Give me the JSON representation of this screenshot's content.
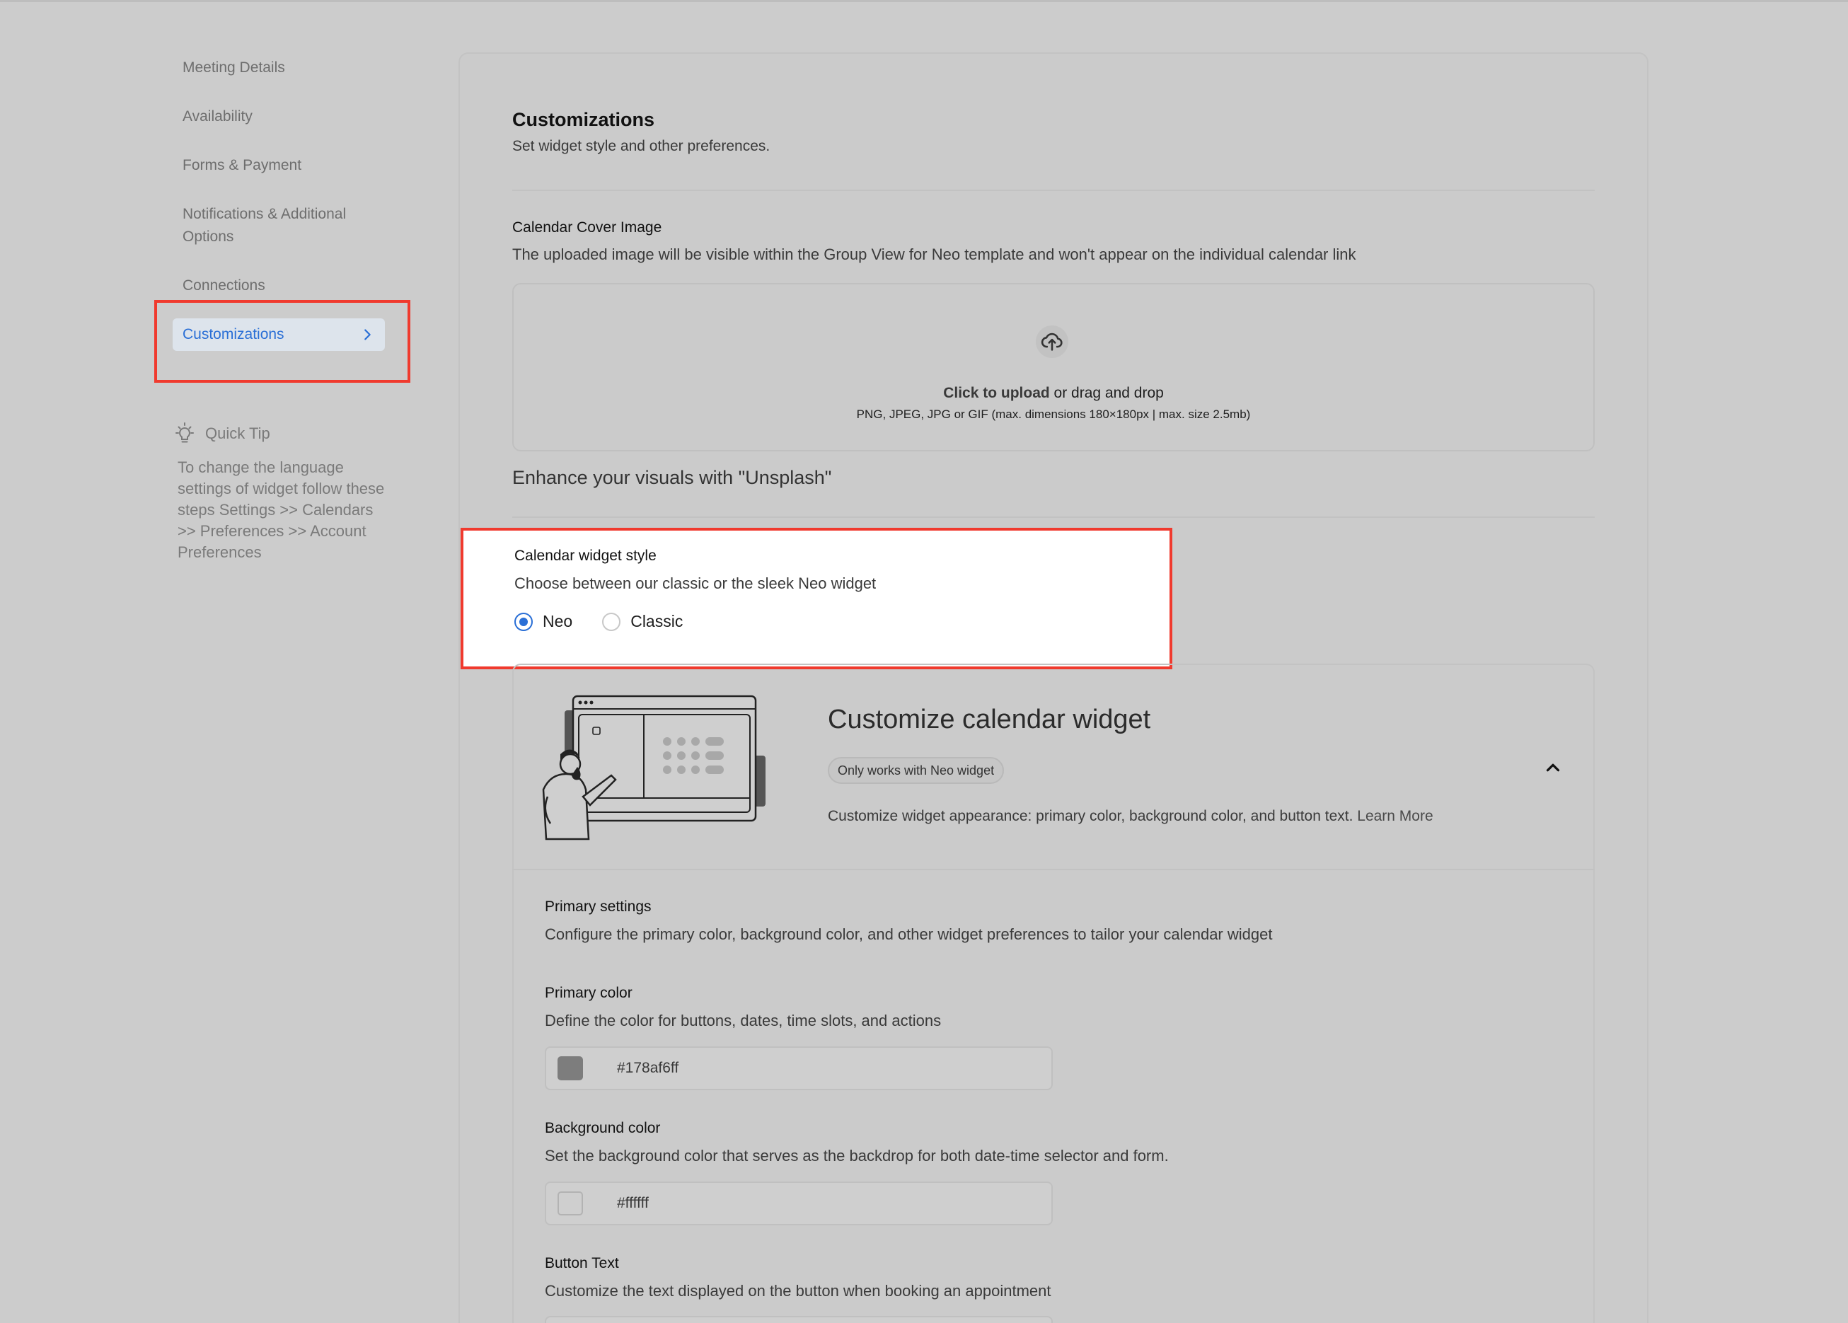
{
  "sidebar": {
    "items": [
      {
        "label": "Meeting Details"
      },
      {
        "label": "Availability"
      },
      {
        "label": "Forms & Payment"
      },
      {
        "label": "Notifications & Additional Options"
      },
      {
        "label": "Connections"
      },
      {
        "label": "Customizations",
        "active": true
      }
    ],
    "quick_tip": {
      "title": "Quick Tip",
      "text": "To change the language settings of widget follow these steps Settings >> Calendars >> Preferences >> Account Preferences"
    }
  },
  "main": {
    "title": "Customizations",
    "subtitle": "Set widget style and other preferences.",
    "cover_image": {
      "label": "Calendar Cover Image",
      "description": "The uploaded image will be visible within the Group View for Neo template and won't appear on the individual calendar link",
      "upload_link": "Click to upload",
      "upload_rest": " or drag and drop",
      "upload_hint": "PNG, JPEG, JPG or GIF (max. dimensions 180×180px | max. size 2.5mb)"
    },
    "unsplash": "Enhance your visuals with \"Unsplash\"",
    "widget_style": {
      "label": "Calendar widget style",
      "description": "Choose between our classic or the sleek Neo widget",
      "options": [
        {
          "label": "Neo",
          "selected": true
        },
        {
          "label": "Classic",
          "selected": false
        }
      ]
    },
    "customize_widget": {
      "title": "Customize calendar widget",
      "badge": "Only works with Neo widget",
      "description": "Customize widget appearance: primary color, background color, and button text.",
      "learn_more": "Learn More",
      "primary_settings": {
        "label": "Primary settings",
        "description": "Configure the primary color, background color, and other widget preferences to tailor your calendar widget"
      },
      "primary_color": {
        "label": "Primary color",
        "description": "Define the color for buttons, dates, time slots, and actions",
        "value": "#178af6ff",
        "swatch": "#7d7d7d"
      },
      "background_color": {
        "label": "Background color",
        "description": "Set the background color that serves as the backdrop for both date-time selector and form.",
        "value": "#ffffff",
        "swatch": "#cfcfcf"
      },
      "button_text": {
        "label": "Button Text",
        "description": "Customize the text displayed on the button when booking an appointment"
      }
    }
  },
  "colors": {
    "accent": "#2a6fd6",
    "highlight": "#f03a2e",
    "overlay": "#cccccc"
  }
}
